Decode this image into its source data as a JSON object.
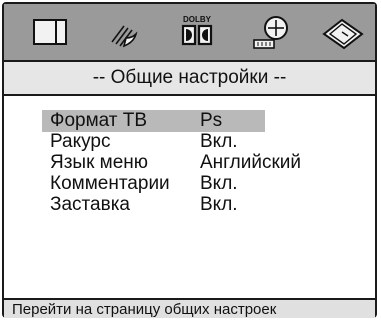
{
  "tabs": [
    {
      "icon": "general-setup-icon"
    },
    {
      "icon": "audio-setup-icon"
    },
    {
      "icon": "dolby-digital-icon",
      "text": "DOLBY"
    },
    {
      "icon": "video-setup-icon"
    },
    {
      "icon": "preference-icon"
    }
  ],
  "title": "-- Общие настройки --",
  "menu": [
    {
      "label": "Формат ТВ",
      "value": "Ps",
      "selected": true
    },
    {
      "label": "Ракурс",
      "value": "Вкл."
    },
    {
      "label": "Язык меню",
      "value": "Английский"
    },
    {
      "label": "Комментарии",
      "value": "Вкл."
    },
    {
      "label": "Заставка",
      "value": "Вкл."
    }
  ],
  "status": "Перейти на страницу общих настроек"
}
